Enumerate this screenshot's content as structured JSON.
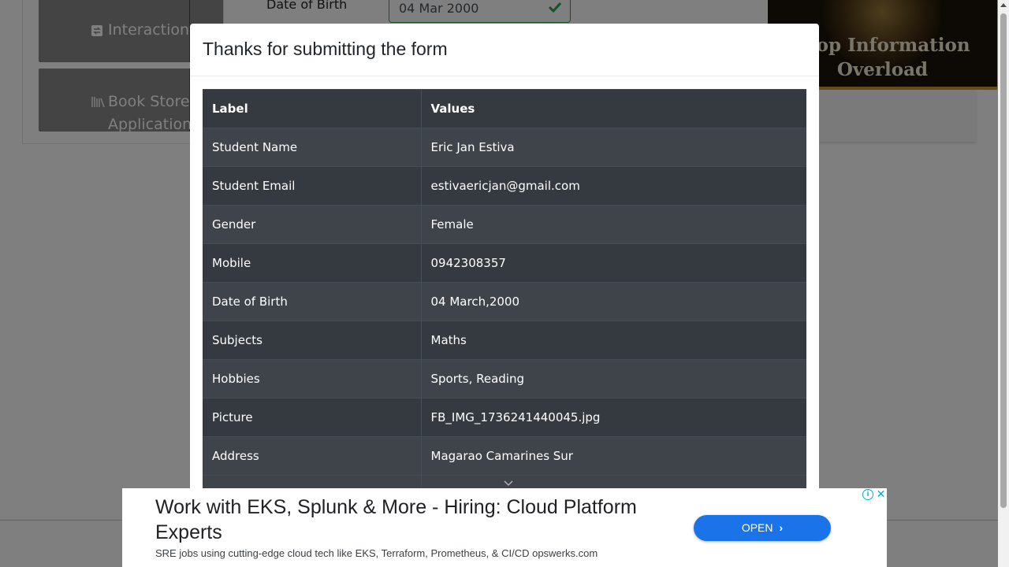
{
  "background": {
    "sidebar": {
      "groups": [
        {
          "label": "Interactions",
          "icon": "interactions-icon"
        },
        {
          "label": "Book Store Application",
          "icon": "bookshelf-icon"
        }
      ]
    },
    "form": {
      "dob_label": "Date of Birth",
      "dob_value": "04 Mar 2000"
    },
    "side_ad": {
      "line1": "Stop Information",
      "line2": "Overload"
    }
  },
  "modal": {
    "title": "Thanks for submitting the form",
    "table": {
      "headers": [
        "Label",
        "Values"
      ],
      "rows": [
        {
          "label": "Student Name",
          "value": "Eric Jan Estiva"
        },
        {
          "label": "Student Email",
          "value": "estivaericjan@gmail.com"
        },
        {
          "label": "Gender",
          "value": "Female"
        },
        {
          "label": "Mobile",
          "value": "0942308357"
        },
        {
          "label": "Date of Birth",
          "value": "04 March,2000"
        },
        {
          "label": "Subjects",
          "value": "Maths"
        },
        {
          "label": "Hobbies",
          "value": "Sports, Reading"
        },
        {
          "label": "Picture",
          "value": "FB_IMG_1736241440045.jpg"
        },
        {
          "label": "Address",
          "value": "Magarao Camarines Sur"
        }
      ]
    }
  },
  "bottom_ad": {
    "headline": "Work with EKS, Splunk & More - Hiring: Cloud Platform Experts",
    "subtext": "SRE jobs using cutting-edge cloud tech like EKS, Terraform, Prometheus, & CI/CD opswerks.com",
    "cta_label": "OPEN",
    "cta_color": "#1a73e8"
  },
  "colors": {
    "table_header_bg": "#343a40",
    "table_stripe_bg": "#3e444a",
    "valid_green": "#28a745",
    "overlay": "rgba(0,0,0,0.5)"
  }
}
